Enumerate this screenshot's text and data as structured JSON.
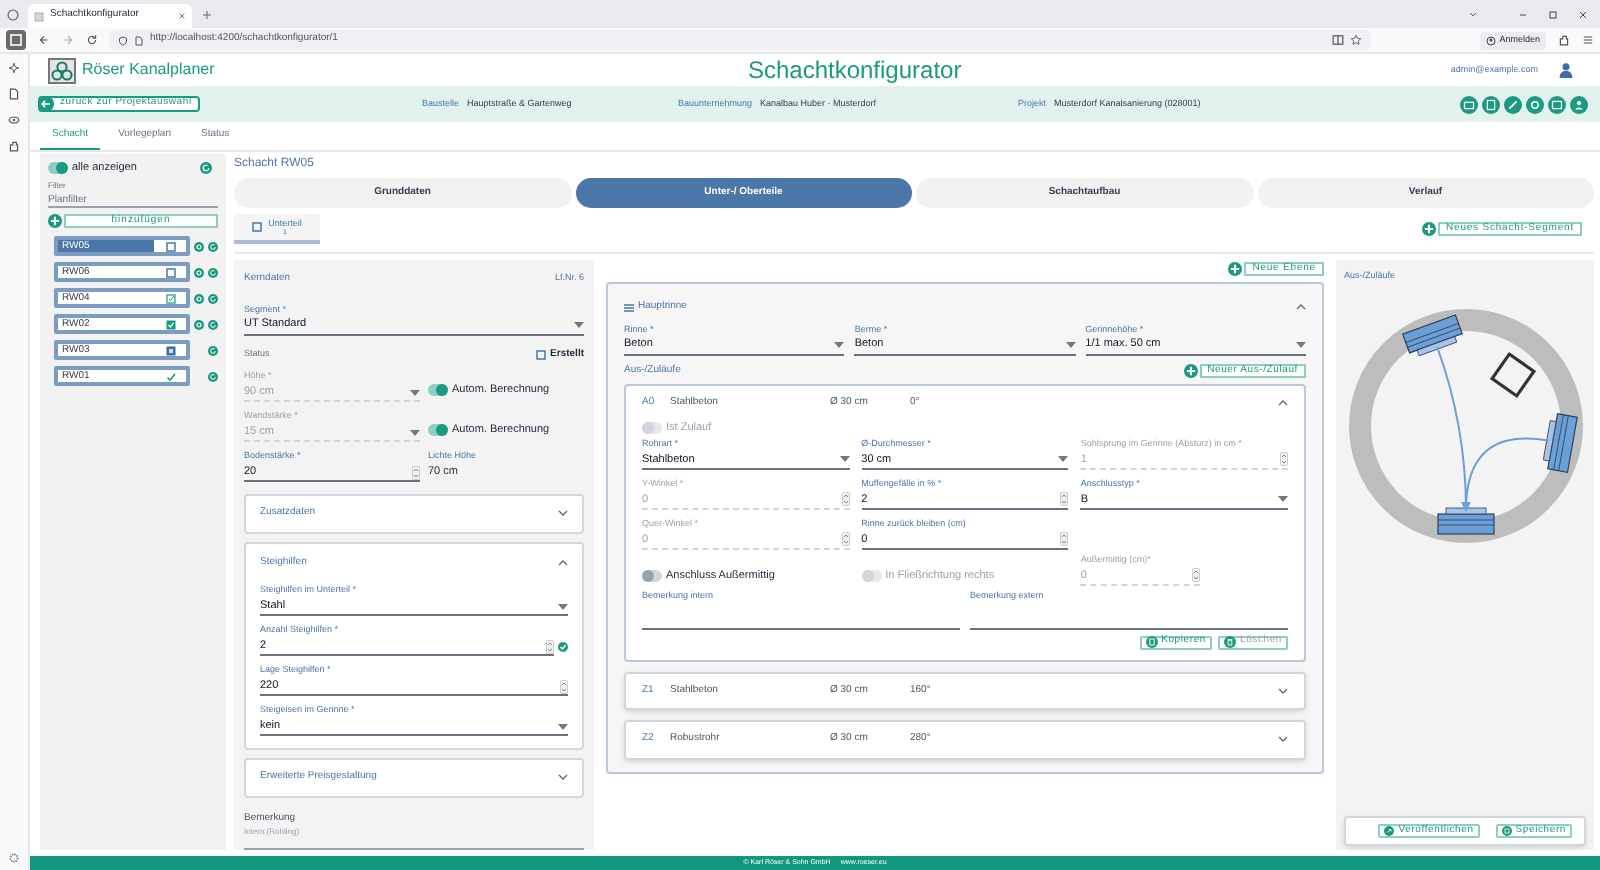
{
  "browser": {
    "tab_title": "Schachtkonfigurator",
    "url": "http://localhost:4200/schachtkonfigurator/1",
    "sign_in": "Anmelden"
  },
  "header": {
    "app_name": "Röser Kanalplaner",
    "title": "Schachtkonfigurator",
    "user_email": "admin@example.com"
  },
  "info_bar": {
    "back_button": "zurück zur Projektauswahl",
    "fields": [
      {
        "label": "Baustelle",
        "value": "Hauptstraße & Gartenweg"
      },
      {
        "label": "Bauunternehmung",
        "value": "Kanalbau Huber · Musterdorf"
      },
      {
        "label": "Projekt",
        "value": "Musterdorf Kanalsanierung (028001)"
      }
    ]
  },
  "tabs": [
    {
      "label": "Schacht",
      "selected": true
    },
    {
      "label": "Vorlegeplan",
      "selected": false
    },
    {
      "label": "Status",
      "selected": false
    }
  ],
  "shaft_list": {
    "show_all": {
      "label": "alle anzeigen",
      "on": true
    },
    "filter": {
      "label": "Filter",
      "placeholder": "Planfilter"
    },
    "add_button": "hinzufügen",
    "items": [
      {
        "label": "RW05",
        "selected": true,
        "kind": "open",
        "removable": true
      },
      {
        "label": "RW06",
        "selected": false,
        "kind": "open",
        "removable": true
      },
      {
        "label": "RW04",
        "selected": false,
        "kind": "edited",
        "removable": true
      },
      {
        "label": "RW02",
        "selected": false,
        "kind": "checked",
        "removable": true
      },
      {
        "label": "RW03",
        "selected": false,
        "kind": "released",
        "removable": false
      },
      {
        "label": "RW01",
        "selected": false,
        "kind": "done",
        "removable": false
      }
    ]
  },
  "shaft_title": "Schacht RW05",
  "steps": [
    {
      "label": "Grunddaten",
      "selected": false
    },
    {
      "label": "Unter-/ Oberteile",
      "selected": true
    },
    {
      "label": "Schachtaufbau",
      "selected": false
    },
    {
      "label": "Verlauf",
      "selected": false
    }
  ],
  "segments": [
    {
      "label": "Unterteil",
      "number": "1",
      "selected": true
    }
  ],
  "new_segment_button": "Neues Schacht-Segment",
  "core": {
    "title": "Kerndaten",
    "number": "Lf.Nr. 6",
    "segment": {
      "label": "Segment *",
      "value": "UT Standard",
      "kind": "select"
    },
    "status": {
      "label": "Status",
      "checkbox": {
        "label": "Erstellt",
        "checked": false
      }
    },
    "rows": [
      {
        "field": {
          "label": "Höhe *",
          "value": "90 cm",
          "kind": "select",
          "disabled": true
        },
        "toggle": {
          "label": "Autom. Berechnung",
          "on": true
        }
      },
      {
        "field": {
          "label": "Wandstärke *",
          "value": "15 cm",
          "kind": "select",
          "disabled": true
        },
        "toggle": {
          "label": "Autom. Berechnung",
          "on": true
        }
      }
    ],
    "floor": {
      "label": "Bodenstärke *",
      "value": "20",
      "kind": "number"
    },
    "clear_height": {
      "label": "Lichte Höhe",
      "value": "70 cm",
      "kind": "plain"
    },
    "sections": [
      {
        "title": "Zusatzdaten",
        "expanded": false
      },
      {
        "title": "Steighilfen",
        "expanded": true,
        "fields": [
          {
            "label": "Steighilfen im Unterteil *",
            "value": "Stahl",
            "kind": "select"
          },
          {
            "label": "Anzahl Steighilfen *",
            "value": "2",
            "kind": "number",
            "valid": true
          },
          {
            "label": "Lage Steighilfen *",
            "value": "220",
            "kind": "number"
          },
          {
            "label": "Steigeisen im Gerinne *",
            "value": "kein",
            "kind": "select"
          }
        ]
      },
      {
        "title": "Erweiterte Preisgestaltung",
        "expanded": false
      }
    ],
    "remark": {
      "label": "Bemerkung",
      "placeholder": "Intern (Rohling)"
    }
  },
  "new_level_button": "Neue Ebene",
  "channel": {
    "title": "Hauptrinne",
    "expanded": true,
    "fields": [
      {
        "label": "Rinne *",
        "value": "Beton",
        "kind": "select"
      },
      {
        "label": "Berme *",
        "value": "Beton",
        "kind": "select"
      },
      {
        "label": "Gerinnehöhe *",
        "value": "1/1 max. 50 cm",
        "kind": "select"
      }
    ]
  },
  "connections": {
    "title": "Aus-/Zuläufe",
    "new_button": "Neuer Aus-/Zulauf",
    "items": [
      {
        "id": "A0",
        "kind": "outflow",
        "material": "Stahlbeton",
        "diameter": "Ø 30 cm",
        "angle": "0°",
        "expanded": true,
        "detail": {
          "inflow_toggle": {
            "label": "Ist Zulauf",
            "on": false,
            "disabled": true
          },
          "fields": [
            {
              "label": "Rohrart *",
              "value": "Stahlbeton",
              "kind": "select",
              "disabled": false
            },
            {
              "label": "Ø-Durchmesser *",
              "value": "30 cm",
              "kind": "select",
              "disabled": false
            },
            {
              "label": "Sohlsprung im Gerinne (Absturz) in cm *",
              "value": "1",
              "kind": "number",
              "disabled": true
            },
            {
              "label": "Y-Winkel *",
              "value": "0",
              "kind": "number",
              "disabled": true
            },
            {
              "label": "Muffengefälle in % *",
              "value": "2",
              "kind": "number",
              "disabled": false
            },
            {
              "label": "Anschlusstyp *",
              "value": "B",
              "kind": "select",
              "disabled": false
            },
            {
              "label": "Quer-Winkel *",
              "value": "0",
              "kind": "number",
              "disabled": true
            },
            {
              "label": "Rinne zurück bleiben (cm)",
              "value": "0",
              "kind": "number",
              "disabled": false
            }
          ],
          "toggles": [
            {
              "label": "Anschluss Außermittig",
              "on": false,
              "disabled": false
            },
            {
              "label": "In Fließrichtung rechts",
              "on": false,
              "disabled": true
            }
          ],
          "offset": {
            "label": "Außermittig (cm)*",
            "value": "0",
            "kind": "number",
            "disabled": true
          },
          "remarks": [
            {
              "label": "Bemerkung intern"
            },
            {
              "label": "Bemerkung extern"
            }
          ],
          "buttons": [
            {
              "kind": "copy",
              "label": "Kopieren",
              "disabled": false
            },
            {
              "kind": "delete",
              "label": "Löschen",
              "disabled": true
            }
          ]
        }
      },
      {
        "id": "Z1",
        "kind": "inflow",
        "material": "Stahlbeton",
        "diameter": "Ø 30 cm",
        "angle": "160°",
        "expanded": false
      },
      {
        "id": "Z2",
        "kind": "inflow",
        "material": "Robustrohr",
        "diameter": "Ø 30 cm",
        "angle": "280°",
        "expanded": false
      }
    ]
  },
  "diagram": {
    "title": "Aus-/Zuläufe"
  },
  "actions": [
    {
      "kind": "publish",
      "label": "Veröffentlichen"
    },
    {
      "kind": "save",
      "label": "Speichern"
    }
  ],
  "footer": {
    "copyright": "© Karl Röser & Sohn GmbH",
    "website": "www.roeser.eu"
  }
}
